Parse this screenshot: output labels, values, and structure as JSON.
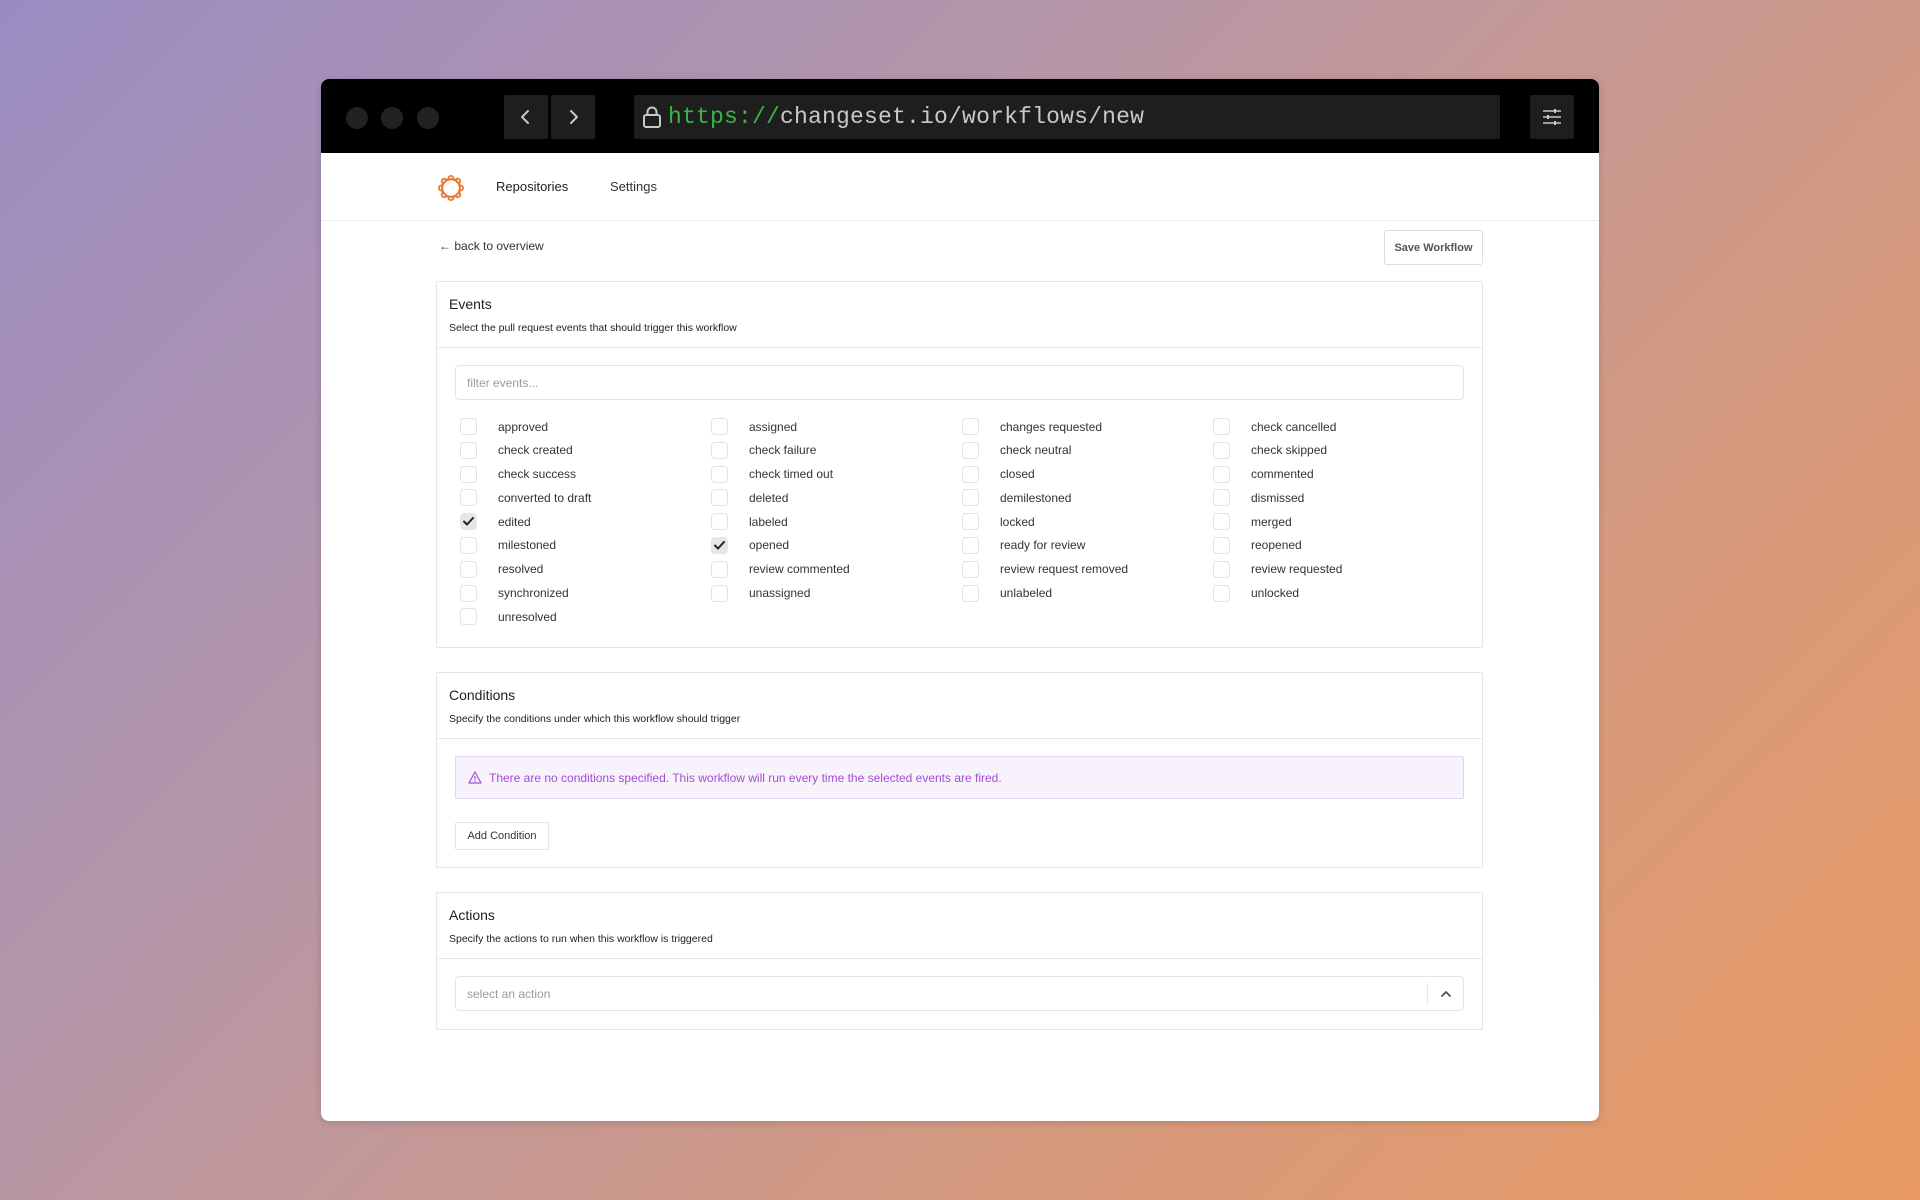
{
  "browser": {
    "url_protocol": "https://",
    "url_rest": "changeset.io/workflows/new"
  },
  "appnav": {
    "items": [
      {
        "label": "Repositories"
      },
      {
        "label": "Settings"
      }
    ]
  },
  "toolbar": {
    "back_label": "back to overview",
    "save_label": "Save Workflow"
  },
  "events": {
    "title": "Events",
    "subtitle": "Select the pull request events that should trigger this workflow",
    "filter_placeholder": "filter events...",
    "items": [
      {
        "label": "approved",
        "checked": false
      },
      {
        "label": "assigned",
        "checked": false
      },
      {
        "label": "changes requested",
        "checked": false
      },
      {
        "label": "check cancelled",
        "checked": false
      },
      {
        "label": "check created",
        "checked": false
      },
      {
        "label": "check failure",
        "checked": false
      },
      {
        "label": "check neutral",
        "checked": false
      },
      {
        "label": "check skipped",
        "checked": false
      },
      {
        "label": "check success",
        "checked": false
      },
      {
        "label": "check timed out",
        "checked": false
      },
      {
        "label": "closed",
        "checked": false
      },
      {
        "label": "commented",
        "checked": false
      },
      {
        "label": "converted to draft",
        "checked": false
      },
      {
        "label": "deleted",
        "checked": false
      },
      {
        "label": "demilestoned",
        "checked": false
      },
      {
        "label": "dismissed",
        "checked": false
      },
      {
        "label": "edited",
        "checked": true
      },
      {
        "label": "labeled",
        "checked": false
      },
      {
        "label": "locked",
        "checked": false
      },
      {
        "label": "merged",
        "checked": false
      },
      {
        "label": "milestoned",
        "checked": false
      },
      {
        "label": "opened",
        "checked": true
      },
      {
        "label": "ready for review",
        "checked": false
      },
      {
        "label": "reopened",
        "checked": false
      },
      {
        "label": "resolved",
        "checked": false
      },
      {
        "label": "review commented",
        "checked": false
      },
      {
        "label": "review request removed",
        "checked": false
      },
      {
        "label": "review requested",
        "checked": false
      },
      {
        "label": "synchronized",
        "checked": false
      },
      {
        "label": "unassigned",
        "checked": false
      },
      {
        "label": "unlabeled",
        "checked": false
      },
      {
        "label": "unlocked",
        "checked": false
      },
      {
        "label": "unresolved",
        "checked": false
      }
    ]
  },
  "conditions": {
    "title": "Conditions",
    "subtitle": "Specify the conditions under which this workflow should trigger",
    "alert": "There are no conditions specified. This workflow will run every time the selected events are fired.",
    "add_label": "Add Condition"
  },
  "actions": {
    "title": "Actions",
    "subtitle": "Specify the actions to run when this workflow is triggered",
    "select_placeholder": "select an action"
  },
  "colors": {
    "brand": "#e8772e",
    "url_protocol": "#3bb34a",
    "alert_text": "#a24fd2",
    "alert_bg": "#f8f2fc"
  }
}
